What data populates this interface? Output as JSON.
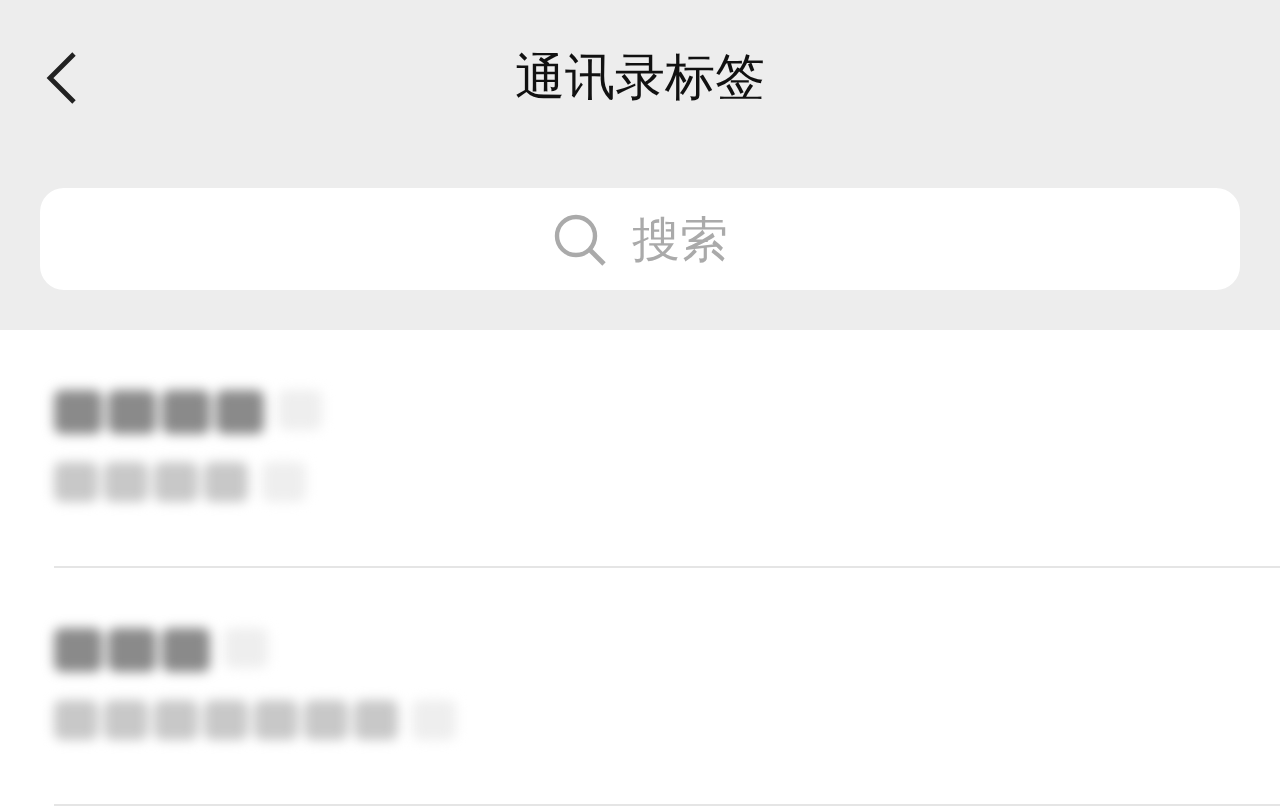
{
  "header": {
    "title": "通讯录标签"
  },
  "search": {
    "placeholder": "搜索"
  },
  "tags": [
    {
      "kind": "short"
    },
    {
      "kind": "long"
    }
  ]
}
